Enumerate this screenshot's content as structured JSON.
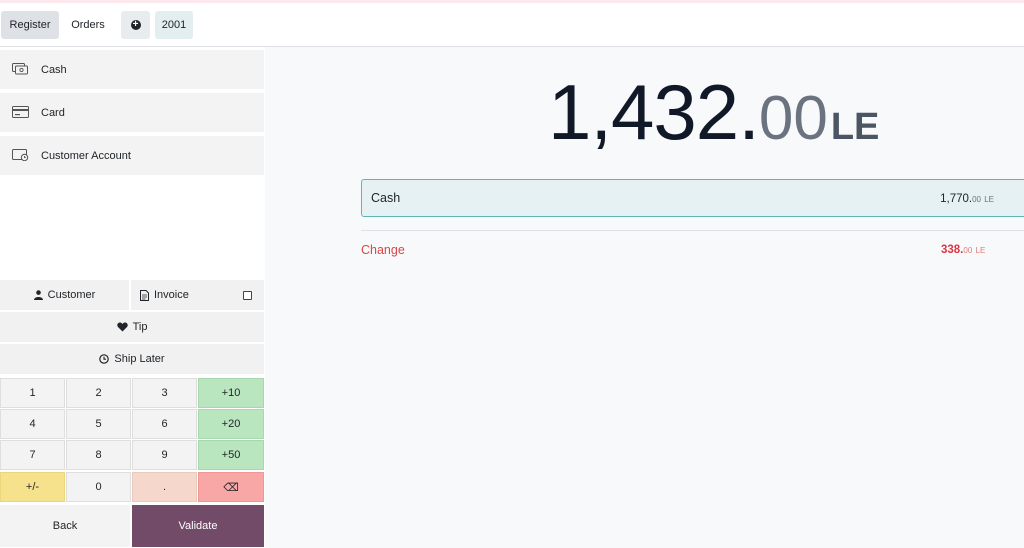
{
  "topbar": {
    "register_label": "Register",
    "orders_label": "Orders",
    "new_order_icon": "plus-circle-icon",
    "order_number": "2001"
  },
  "payment_methods": [
    {
      "label": "Cash",
      "icon": "cash-icon"
    },
    {
      "label": "Card",
      "icon": "card-icon"
    },
    {
      "label": "Customer Account",
      "icon": "customer-account-icon"
    }
  ],
  "controls": {
    "customer_label": "Customer",
    "invoice_label": "Invoice",
    "invoice_checked": false,
    "tip_label": "Tip",
    "ship_later_label": "Ship Later"
  },
  "numpad": {
    "keys": [
      "1",
      "2",
      "3",
      "+10",
      "4",
      "5",
      "6",
      "+20",
      "7",
      "8",
      "9",
      "+50",
      "+/-",
      "0",
      ".",
      "⌫"
    ]
  },
  "actions": {
    "back_label": "Back",
    "validate_label": "Validate"
  },
  "summary": {
    "total_int": "1,432.",
    "total_dec": "00",
    "currency": "LE",
    "payment_line": {
      "method": "Cash",
      "amount_int": "1,770.",
      "amount_dec": "00",
      "currency": "LE"
    },
    "change": {
      "label": "Change",
      "amount_int": "338.",
      "amount_dec": "00",
      "currency": "LE"
    }
  },
  "colors": {
    "accent": "#714b67",
    "change": "#dc3545",
    "payline_border": "#5fb5b0"
  }
}
